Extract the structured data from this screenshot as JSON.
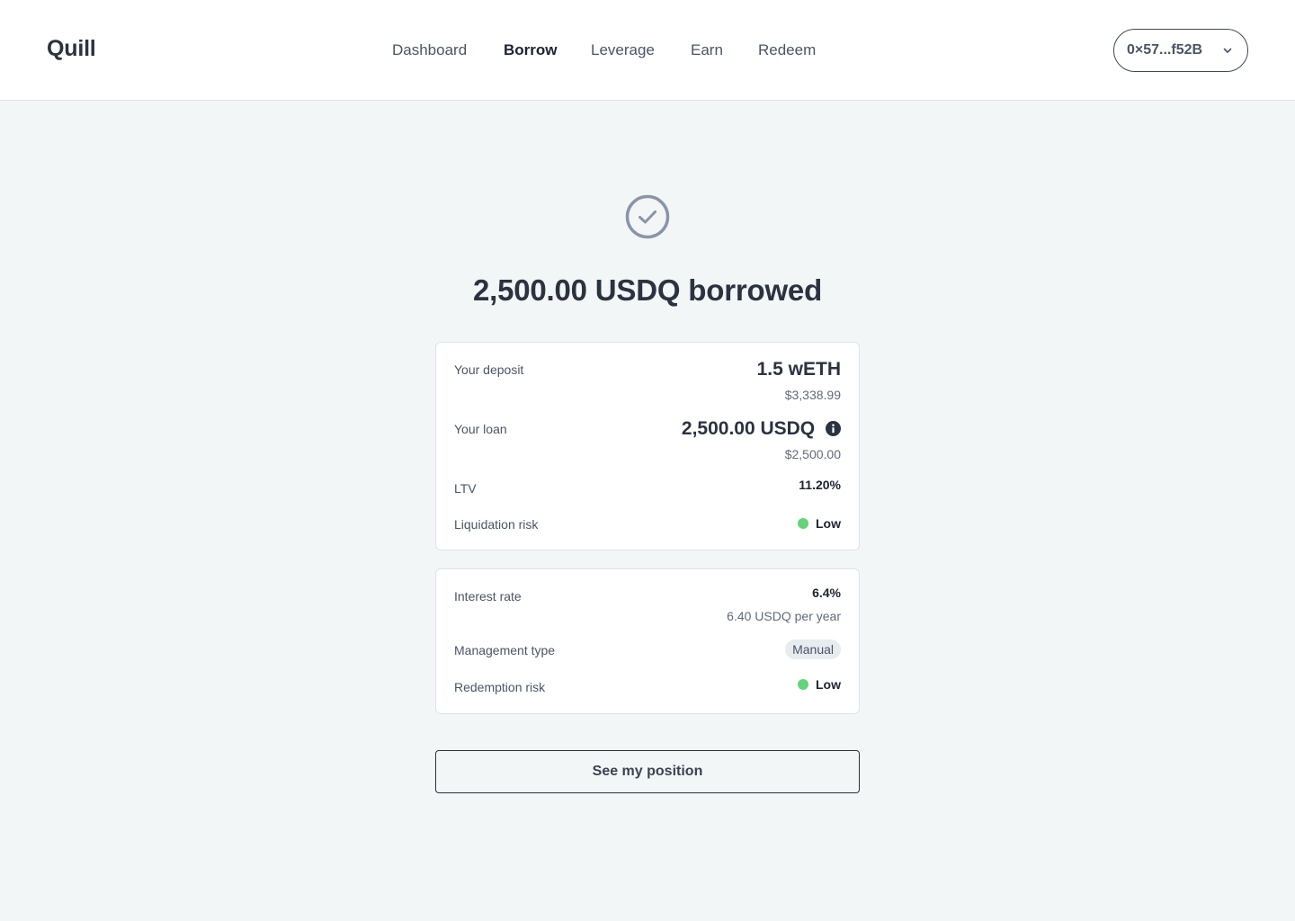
{
  "header": {
    "logo": "Quill",
    "nav": [
      {
        "label": "Dashboard",
        "active": false
      },
      {
        "label": "Borrow",
        "active": true
      },
      {
        "label": "Leverage",
        "active": false
      },
      {
        "label": "Earn",
        "active": false
      },
      {
        "label": "Redeem",
        "active": false
      }
    ],
    "wallet": {
      "address": "0×57...f52B",
      "icon": "chevron-down-icon"
    }
  },
  "success": {
    "icon": "check-circle-icon",
    "headline": "2,500.00 USDQ borrowed"
  },
  "position": {
    "deposit": {
      "label": "Your deposit",
      "value": "1.5 wETH",
      "usd": "$3,338.99"
    },
    "loan": {
      "label": "Your loan",
      "value": "2,500.00 USDQ",
      "usd": "$2,500.00",
      "icon": "info-icon"
    },
    "ltv": {
      "label": "LTV",
      "value": "11.20%"
    },
    "liquidation_risk": {
      "label": "Liquidation risk",
      "value": "Low",
      "color": "#63d47b"
    }
  },
  "terms": {
    "interest_rate": {
      "label": "Interest rate",
      "value": "6.4%",
      "per_year": "6.40 USDQ per year"
    },
    "management_type": {
      "label": "Management type",
      "value": "Manual"
    },
    "redemption_risk": {
      "label": "Redemption risk",
      "value": "Low",
      "color": "#63d47b"
    }
  },
  "actions": {
    "see_position": "See my position"
  },
  "colors": {
    "background": "#f3f6f7",
    "text": "#2b3240",
    "success_icon": "#8995a7",
    "risk_low": "#63d47b"
  }
}
